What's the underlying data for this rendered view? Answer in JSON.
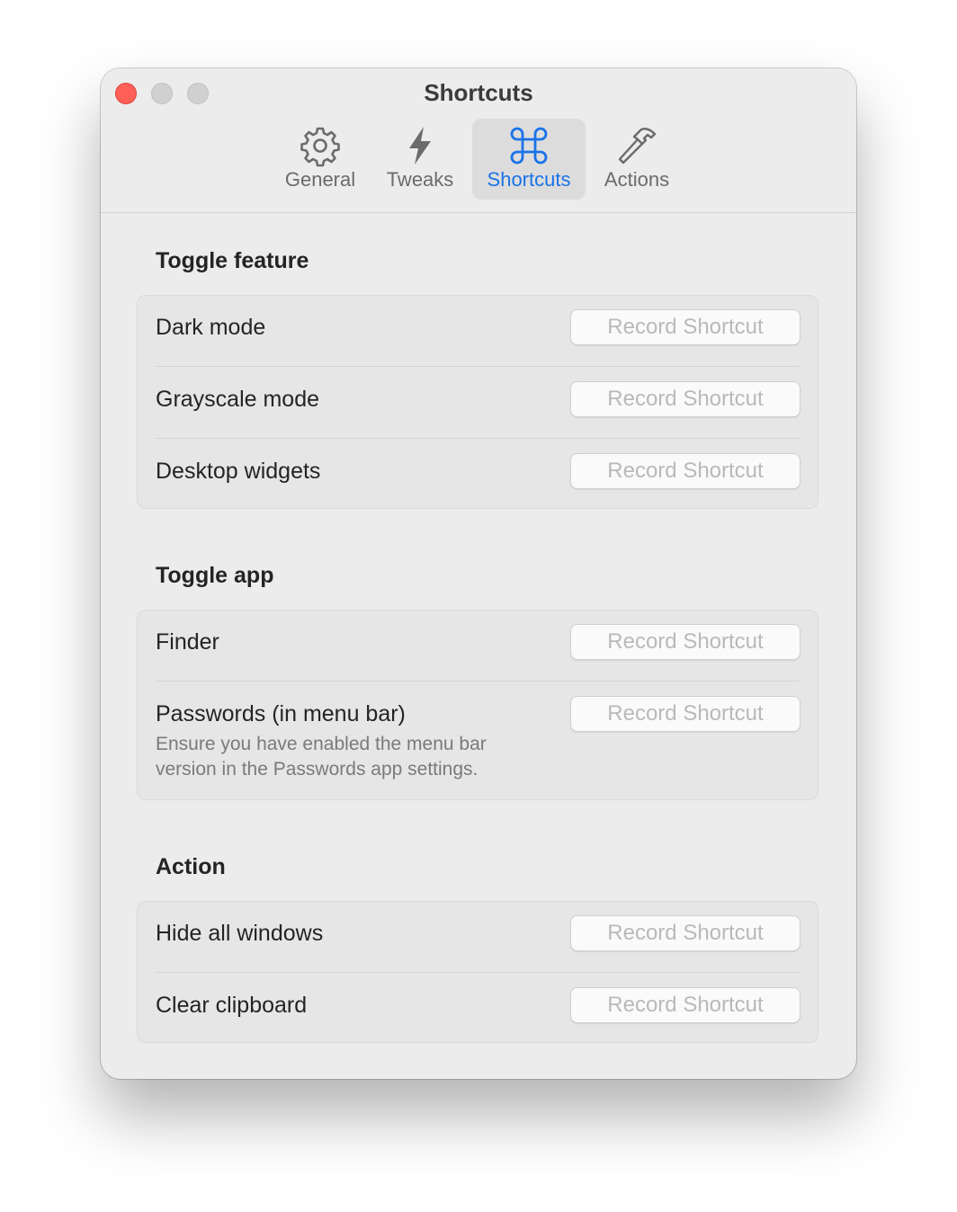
{
  "window": {
    "title": "Shortcuts"
  },
  "tabs": [
    {
      "label": "General",
      "icon": "gear-icon"
    },
    {
      "label": "Tweaks",
      "icon": "bolt-icon"
    },
    {
      "label": "Shortcuts",
      "icon": "command-icon",
      "active": true
    },
    {
      "label": "Actions",
      "icon": "hammer-icon"
    }
  ],
  "sections": {
    "toggle_feature": {
      "title": "Toggle feature",
      "rows": [
        {
          "label": "Dark mode",
          "button": "Record Shortcut"
        },
        {
          "label": "Grayscale mode",
          "button": "Record Shortcut"
        },
        {
          "label": "Desktop widgets",
          "button": "Record Shortcut"
        }
      ]
    },
    "toggle_app": {
      "title": "Toggle app",
      "rows": [
        {
          "label": "Finder",
          "button": "Record Shortcut"
        },
        {
          "label": "Passwords (in menu bar)",
          "button": "Record Shortcut",
          "note": "Ensure you have enabled the menu bar version in the Passwords app settings."
        }
      ]
    },
    "action": {
      "title": "Action",
      "rows": [
        {
          "label": "Hide all windows",
          "button": "Record Shortcut"
        },
        {
          "label": "Clear clipboard",
          "button": "Record Shortcut"
        }
      ]
    }
  },
  "colors": {
    "accent": "#1a73e8",
    "close": "#fe5f57",
    "window_bg": "#ececec"
  }
}
